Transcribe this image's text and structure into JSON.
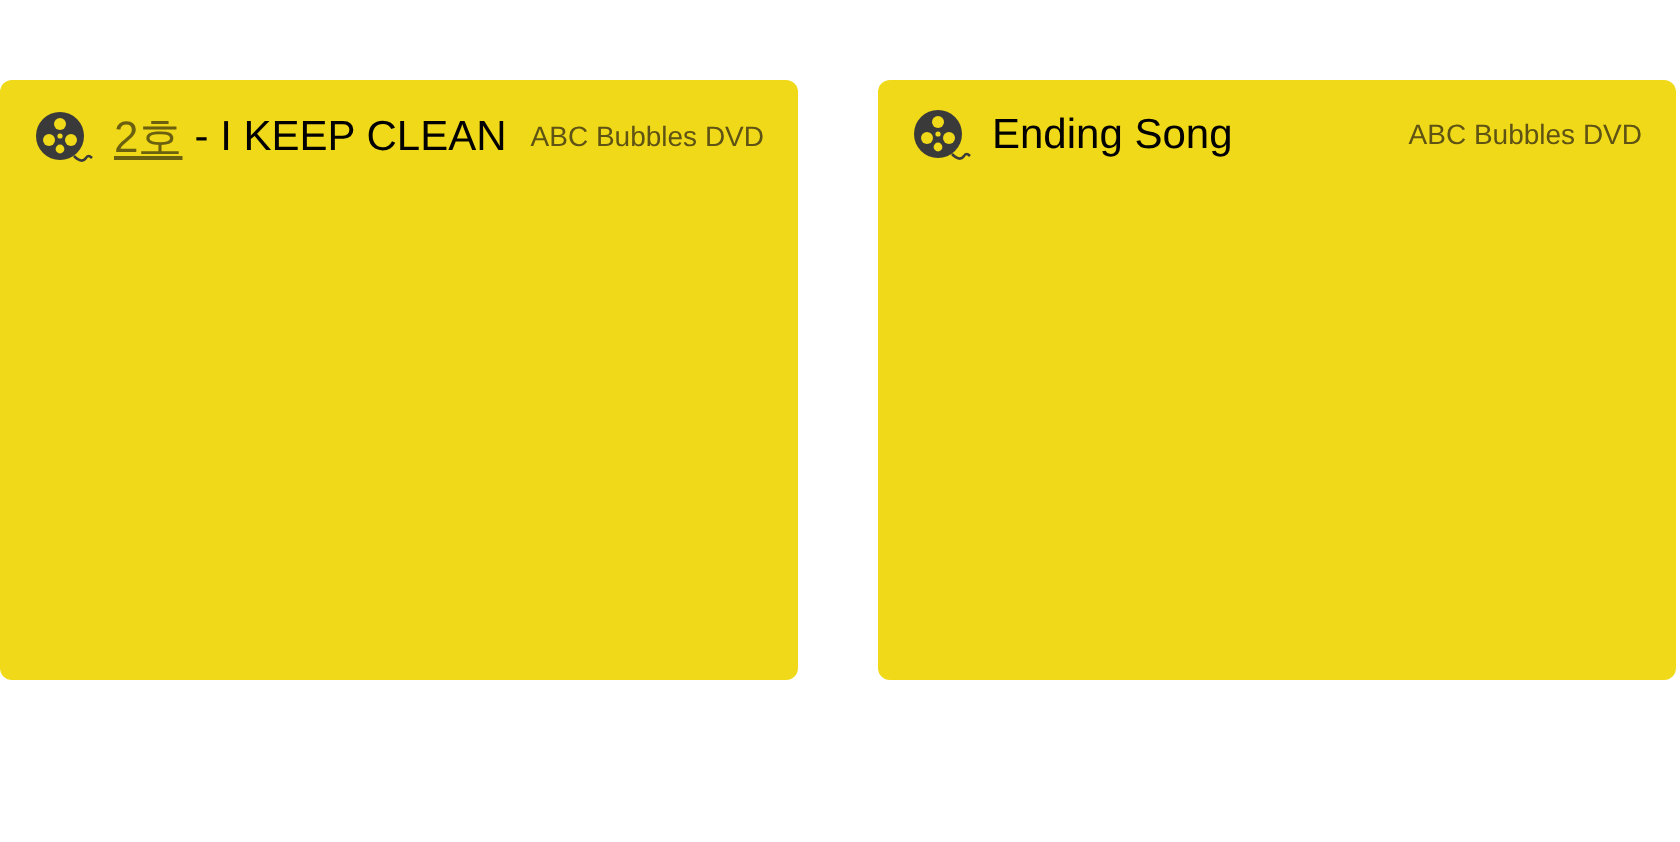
{
  "cards": [
    {
      "episode": "2호",
      "title": "- I KEEP CLEAN",
      "source": "ABC Bubbles DVD"
    },
    {
      "title": "Ending Song",
      "source": "ABC Bubbles DVD"
    }
  ]
}
